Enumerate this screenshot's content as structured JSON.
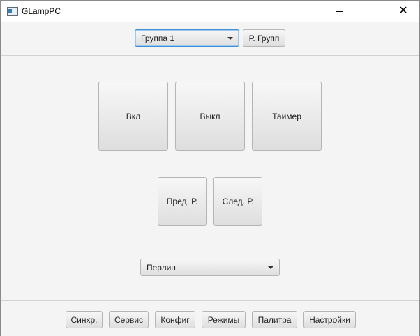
{
  "window": {
    "title": "GLampPC",
    "minimize_icon": "minimize-icon",
    "maximize_icon": "maximize-icon",
    "close_glyph": "✕"
  },
  "top_bar": {
    "group_select": {
      "selected": "Группа 1"
    },
    "group_edit_label": "Р. Групп"
  },
  "controls": {
    "on_label": "Вкл",
    "off_label": "Выкл",
    "timer_label": "Таймер",
    "prev_label": "Пред. Р.",
    "next_label": "След. Р."
  },
  "mode_select": {
    "selected": "Перлин"
  },
  "bottom_bar": {
    "sync_label": "Синхр.",
    "service_label": "Сервис",
    "config_label": "Конфиг",
    "modes_label": "Режимы",
    "palette_label": "Палитра",
    "settings_label": "Настройки"
  }
}
